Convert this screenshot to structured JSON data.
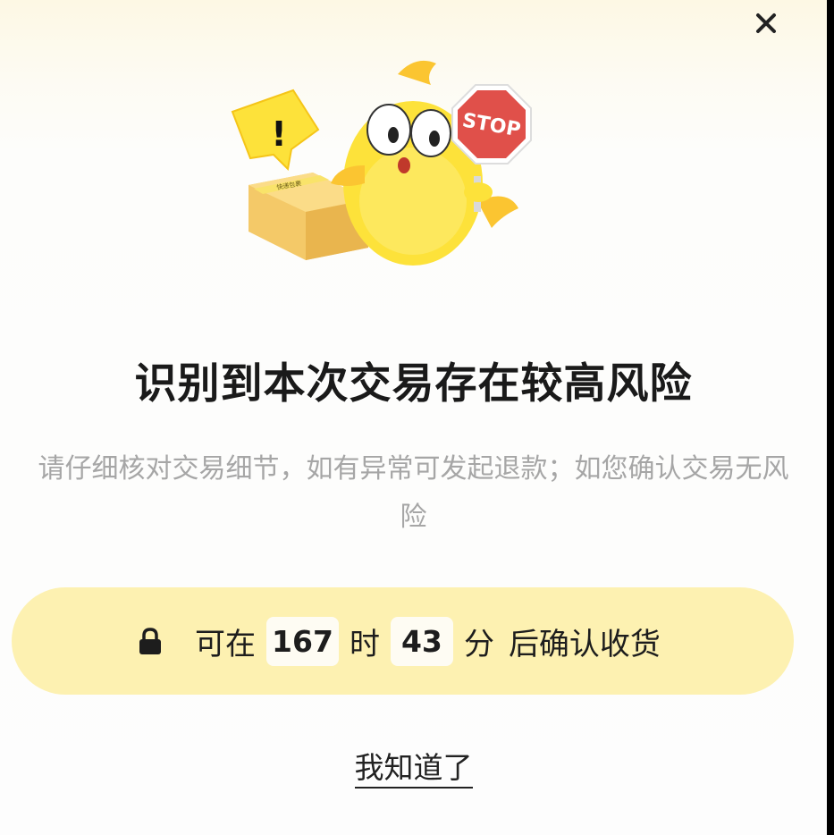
{
  "dialog": {
    "close_icon": "close-icon",
    "illustration": {
      "sign_text": "STOP",
      "alert_mark": "!",
      "box_tape_text": "快递包裹"
    },
    "title": "识别到本次交易存在较高风险",
    "description": "请仔细核对交易细节，如有异常可发起退款；如您确认交易无风险",
    "timer": {
      "lock_icon": "lock-icon",
      "prefix": "可在",
      "hours": "167",
      "hours_unit": "时",
      "minutes": "43",
      "minutes_unit": "分",
      "suffix": "后确认收货"
    },
    "acknowledge_label": "我知道了"
  },
  "colors": {
    "timer_bg": "#fdf1b1",
    "title": "#1a1a1a",
    "description": "#a6a6a6",
    "stop_sign": "#e0504a",
    "mascot": "#fde23a"
  }
}
